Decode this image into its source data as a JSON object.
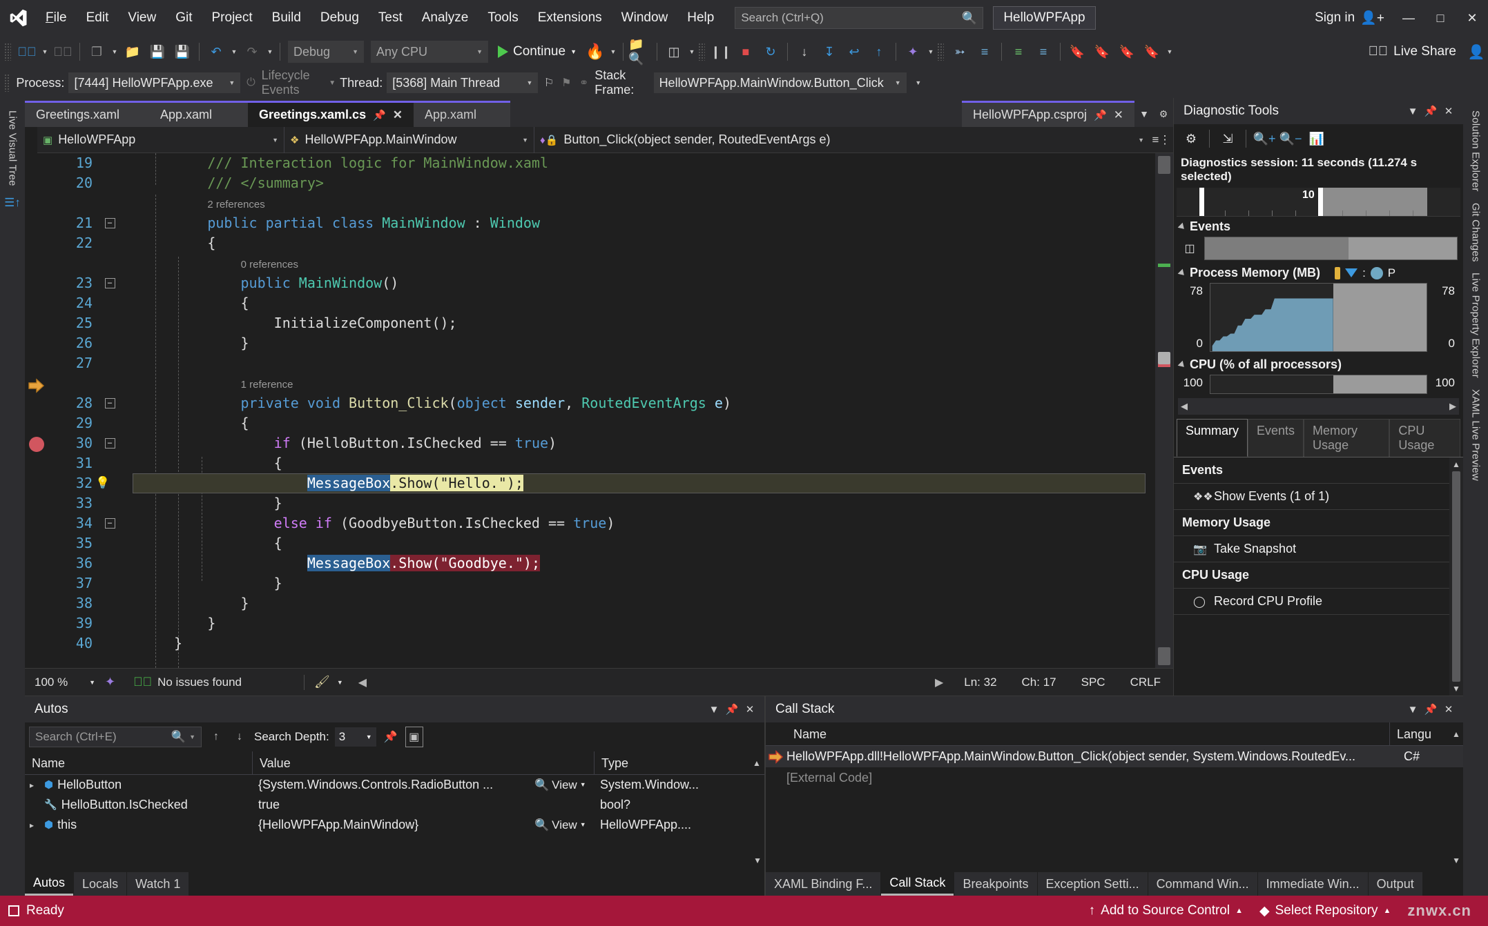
{
  "titlebar": {
    "logo_icon": "visual-studio-logo",
    "menus": [
      "File",
      "Edit",
      "View",
      "Git",
      "Project",
      "Build",
      "Debug",
      "Test",
      "Analyze",
      "Tools",
      "Extensions",
      "Window",
      "Help"
    ],
    "search_placeholder": "Search (Ctrl+Q)",
    "search_icon": "magnifier-icon",
    "project_name": "HelloWPFApp",
    "signin_label": "Sign in",
    "signin_icon": "person-add-icon",
    "minimize_icon": "minimize-icon",
    "maximize_icon": "maximize-icon",
    "close_icon": "close-icon"
  },
  "toolbar": {
    "back_icon": "navigate-back-icon",
    "forward_icon": "navigate-forward-icon",
    "new_item_icon": "new-item-icon",
    "open_file_icon": "open-file-icon",
    "save_icon": "save-icon",
    "save_all_icon": "save-all-icon",
    "undo_icon": "undo-icon",
    "redo_icon": "redo-icon",
    "config_value": "Debug",
    "platform_value": "Any CPU",
    "continue_label": "Continue",
    "hot_reload_icon": "hot-reload-icon",
    "live_share_label": "Live Share",
    "live_share_icon": "live-share-icon",
    "feedback_icon": "send-feedback-icon"
  },
  "debugbar": {
    "process_label": "Process:",
    "process_value": "[7444] HelloWPFApp.exe",
    "lifecycle_label": "Lifecycle Events",
    "thread_label": "Thread:",
    "thread_value": "[5368] Main Thread",
    "stackframe_label": "Stack Frame:",
    "stackframe_value": "HelloWPFApp.MainWindow.Button_Click"
  },
  "left_rail": {
    "items": [
      "Live Visual Tree"
    ],
    "icon": "live-visual-tree-icon"
  },
  "right_rail": {
    "items": [
      "Solution Explorer",
      "Git Changes",
      "Live Property Explorer",
      "XAML Live Preview"
    ]
  },
  "editor": {
    "tabs": [
      {
        "label": "Greetings.xaml",
        "state": "preview"
      },
      {
        "label": "App.xaml",
        "state": "preview"
      },
      {
        "label": "Greetings.xaml.cs",
        "state": "active",
        "pin_icon": "pin-icon",
        "close_icon": "close-icon"
      },
      {
        "label": "App.xaml",
        "state": "preview"
      }
    ],
    "right_tabs": [
      {
        "label": "HelloWPFApp.csproj",
        "pin_icon": "pin-icon",
        "close_icon": "close-icon"
      }
    ],
    "tab_overflow_icon": "chevron-down-icon",
    "tab_settings_icon": "gear-icon",
    "nav": {
      "project": "HelloWPFApp",
      "project_icon": "csharp-file-icon",
      "type": "HelloWPFApp.MainWindow",
      "type_icon": "class-icon",
      "member": "Button_Click(object sender, RoutedEventArgs e)",
      "member_icon": "method-private-icon",
      "split_icon": "split-window-icon"
    },
    "lines": [
      {
        "n": "19",
        "annot": null,
        "fold": null,
        "tokens": [
          {
            "t": "        ",
            "c": "pln"
          },
          {
            "t": "/// Interaction logic for MainWindow.xaml",
            "c": "cmt"
          }
        ]
      },
      {
        "n": "20",
        "annot": null,
        "fold": null,
        "tokens": [
          {
            "t": "        ",
            "c": "pln"
          },
          {
            "t": "/// </summary>",
            "c": "cmt"
          }
        ]
      },
      {
        "n": "",
        "annot": "2 references",
        "annot_indent": 8,
        "fold": null,
        "tokens": []
      },
      {
        "n": "21",
        "annot": null,
        "fold": "minus",
        "tokens": [
          {
            "t": "        ",
            "c": "pln"
          },
          {
            "t": "public partial class ",
            "c": "kw"
          },
          {
            "t": "MainWindow ",
            "c": "typ"
          },
          {
            "t": ": ",
            "c": "pln"
          },
          {
            "t": "Window",
            "c": "typ"
          }
        ]
      },
      {
        "n": "22",
        "annot": null,
        "fold": null,
        "tokens": [
          {
            "t": "        {",
            "c": "pln"
          }
        ]
      },
      {
        "n": "",
        "annot": "0 references",
        "annot_indent": 12,
        "fold": null,
        "tokens": []
      },
      {
        "n": "23",
        "annot": null,
        "fold": "minus",
        "tokens": [
          {
            "t": "            ",
            "c": "pln"
          },
          {
            "t": "public ",
            "c": "kw"
          },
          {
            "t": "MainWindow",
            "c": "typ"
          },
          {
            "t": "()",
            "c": "pln"
          }
        ]
      },
      {
        "n": "24",
        "annot": null,
        "fold": null,
        "tokens": [
          {
            "t": "            {",
            "c": "pln"
          }
        ]
      },
      {
        "n": "25",
        "annot": null,
        "fold": null,
        "tokens": [
          {
            "t": "                ",
            "c": "pln"
          },
          {
            "t": "InitializeComponent",
            "c": "pln"
          },
          {
            "t": "();",
            "c": "pln"
          }
        ]
      },
      {
        "n": "26",
        "annot": null,
        "fold": null,
        "tokens": [
          {
            "t": "            }",
            "c": "pln"
          }
        ]
      },
      {
        "n": "27",
        "annot": null,
        "fold": null,
        "tokens": []
      },
      {
        "n": "",
        "annot": "1 reference",
        "annot_indent": 12,
        "fold": null,
        "tokens": []
      },
      {
        "n": "28",
        "annot": null,
        "fold": "minus",
        "tokens": [
          {
            "t": "            ",
            "c": "pln"
          },
          {
            "t": "private void ",
            "c": "kw"
          },
          {
            "t": "Button_Click",
            "c": "fn"
          },
          {
            "t": "(",
            "c": "pln"
          },
          {
            "t": "object ",
            "c": "kw"
          },
          {
            "t": "sender",
            "c": "par"
          },
          {
            "t": ", ",
            "c": "pln"
          },
          {
            "t": "RoutedEventArgs ",
            "c": "typ"
          },
          {
            "t": "e",
            "c": "par"
          },
          {
            "t": ")",
            "c": "pln"
          }
        ]
      },
      {
        "n": "29",
        "annot": null,
        "fold": null,
        "tokens": [
          {
            "t": "            {",
            "c": "pln"
          }
        ]
      },
      {
        "n": "30",
        "annot": null,
        "fold": "minus",
        "tokens": [
          {
            "t": "                ",
            "c": "pln"
          },
          {
            "t": "if ",
            "c": "kw2"
          },
          {
            "t": "(HelloButton.IsChecked == ",
            "c": "pln"
          },
          {
            "t": "true",
            "c": "kw"
          },
          {
            "t": ")",
            "c": "pln"
          }
        ]
      },
      {
        "n": "31",
        "annot": null,
        "fold": null,
        "tokens": [
          {
            "t": "                {",
            "c": "pln"
          }
        ]
      },
      {
        "n": "32",
        "annot": null,
        "fold": null,
        "state": "current",
        "tokens": [
          {
            "t": "                    ",
            "c": "pln"
          },
          {
            "t": "MessageBox",
            "c": "sel"
          },
          {
            "t": ".Show(\"Hello.\");",
            "c": "yellow"
          }
        ]
      },
      {
        "n": "33",
        "annot": null,
        "fold": null,
        "tokens": [
          {
            "t": "                }",
            "c": "pln"
          }
        ]
      },
      {
        "n": "34",
        "annot": null,
        "fold": "minus",
        "tokens": [
          {
            "t": "                ",
            "c": "pln"
          },
          {
            "t": "else if ",
            "c": "kw2"
          },
          {
            "t": "(GoodbyeButton.IsChecked == ",
            "c": "pln"
          },
          {
            "t": "true",
            "c": "kw"
          },
          {
            "t": ")",
            "c": "pln"
          }
        ]
      },
      {
        "n": "35",
        "annot": null,
        "fold": null,
        "tokens": [
          {
            "t": "                {",
            "c": "pln"
          }
        ]
      },
      {
        "n": "36",
        "annot": null,
        "fold": null,
        "state": "breakpoint",
        "tokens": [
          {
            "t": "                    ",
            "c": "pln"
          },
          {
            "t": "MessageBox",
            "c": "sel"
          },
          {
            "t": ".Show(\"Goodbye.\");",
            "c": "red"
          }
        ]
      },
      {
        "n": "37",
        "annot": null,
        "fold": null,
        "tokens": [
          {
            "t": "                }",
            "c": "pln"
          }
        ]
      },
      {
        "n": "38",
        "annot": null,
        "fold": null,
        "tokens": [
          {
            "t": "            }",
            "c": "pln"
          }
        ]
      },
      {
        "n": "39",
        "annot": null,
        "fold": null,
        "tokens": [
          {
            "t": "        }",
            "c": "pln"
          }
        ]
      },
      {
        "n": "40",
        "annot": null,
        "fold": null,
        "tokens": [
          {
            "t": "    }",
            "c": "pln"
          }
        ]
      }
    ],
    "status": {
      "zoom": "100 %",
      "zoom_icon": "chevron-down-icon",
      "intellicode_icon": "intellicode-icon",
      "issues_icon": "check-circle-icon",
      "issues_text": "No issues found",
      "pen_icon": "edit-settings-icon",
      "back_icon": "scroll-left-icon",
      "forward_icon": "scroll-right-icon",
      "line": "Ln: 32",
      "col": "Ch: 17",
      "spaces": "SPC",
      "eol": "CRLF"
    }
  },
  "diagnostics": {
    "title": "Diagnostic Tools",
    "dropdown_icon": "chevron-down-icon",
    "pin_icon": "pin-icon",
    "close_icon": "close-icon",
    "toolbar_icons": [
      "gear-icon",
      "export-icon",
      "zoom-in-icon",
      "zoom-out-icon",
      "select-graph-icon"
    ],
    "session_text": "Diagnostics session: 11 seconds (11.274 s selected)",
    "timeline_label": "10",
    "events_section": "Events",
    "events_icon": "events-track-icon",
    "memory_section": "Process Memory (MB)",
    "memory_legend_p": "P",
    "memory_max": "78",
    "memory_min": "0",
    "memory_max_right": "78",
    "memory_min_right": "0",
    "cpu_section": "CPU (% of all processors)",
    "cpu_max": "100",
    "cpu_max_right": "100",
    "tabs": [
      {
        "label": "Summary",
        "active": true
      },
      {
        "label": "Events",
        "active": false
      },
      {
        "label": "Memory Usage",
        "active": false
      },
      {
        "label": "CPU Usage",
        "active": false
      }
    ],
    "summary_groups": [
      {
        "header": "Events",
        "items": [
          {
            "label": "Show Events (1 of 1)",
            "icon": "events-icon"
          }
        ]
      },
      {
        "header": "Memory Usage",
        "items": [
          {
            "label": "Take Snapshot",
            "icon": "camera-icon"
          }
        ]
      },
      {
        "header": "CPU Usage",
        "items": [
          {
            "label": "Record CPU Profile",
            "icon": "record-icon"
          }
        ]
      }
    ]
  },
  "autos": {
    "title": "Autos",
    "dropdown_icon": "chevron-down-icon",
    "pin_icon": "pin-icon",
    "close_icon": "close-icon",
    "search_placeholder": "Search (Ctrl+E)",
    "search_icon": "magnifier-icon",
    "search_dropdown_icon": "chevron-down-icon",
    "up_icon": "arrow-up-icon",
    "down_icon": "arrow-down-icon",
    "depth_label": "Search Depth:",
    "depth_value": "3",
    "pin_value_icon": "pin-value-icon",
    "hex_icon": "hex-display-icon",
    "columns": [
      "Name",
      "Value",
      "Type"
    ],
    "rows": [
      {
        "expander": "▸",
        "icon": "object-icon",
        "name": "HelloButton",
        "value": "{System.Windows.Controls.RadioButton ...",
        "has_view": true,
        "view_label": "View",
        "type": "System.Window..."
      },
      {
        "expander": "",
        "icon": "wrench-icon",
        "name": "HelloButton.IsChecked",
        "value": "true",
        "has_view": false,
        "view_label": "",
        "type": "bool?"
      },
      {
        "expander": "▸",
        "icon": "object-icon",
        "name": "this",
        "value": "{HelloWPFApp.MainWindow}",
        "has_view": true,
        "view_label": "View",
        "type": "HelloWPFApp...."
      }
    ],
    "tabs": [
      {
        "label": "Autos",
        "active": true
      },
      {
        "label": "Locals",
        "active": false
      },
      {
        "label": "Watch 1",
        "active": false
      }
    ]
  },
  "callstack": {
    "title": "Call Stack",
    "dropdown_icon": "chevron-down-icon",
    "pin_icon": "pin-icon",
    "close_icon": "close-icon",
    "columns": [
      "Name",
      "Langu"
    ],
    "rows": [
      {
        "arrow_icon": "current-frame-arrow-icon",
        "name": "HelloWPFApp.dll!HelloWPFApp.MainWindow.Button_Click(object sender, System.Windows.RoutedEv...",
        "lang": "C#",
        "dim": false
      },
      {
        "arrow_icon": null,
        "name": "[External Code]",
        "lang": "",
        "dim": true
      }
    ],
    "tabs": [
      {
        "label": "XAML Binding F...",
        "active": false
      },
      {
        "label": "Call Stack",
        "active": true
      },
      {
        "label": "Breakpoints",
        "active": false
      },
      {
        "label": "Exception Setti...",
        "active": false
      },
      {
        "label": "Command Win...",
        "active": false
      },
      {
        "label": "Immediate Win...",
        "active": false
      },
      {
        "label": "Output",
        "active": false
      }
    ]
  },
  "statusbar": {
    "ready_text": "Ready",
    "ready_icon": "stop-square-icon",
    "source_control_label": "Add to Source Control",
    "source_control_icon": "arrow-up-icon",
    "source_control_caret": "chevron-up-icon",
    "repository_label": "Select Repository",
    "repository_icon": "repository-icon",
    "repository_caret": "chevron-up-icon",
    "watermark": "znwx.cn"
  }
}
